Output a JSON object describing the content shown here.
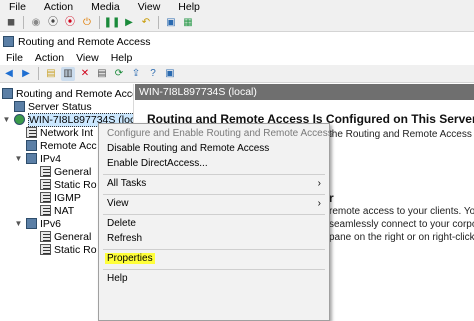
{
  "vm_menu": [
    "File",
    "Action",
    "Media",
    "View",
    "Help"
  ],
  "window_title": "Routing and Remote Access",
  "app_menu": [
    "File",
    "Action",
    "View",
    "Help"
  ],
  "tree": {
    "root": "Routing and Remote Access",
    "server_status": "Server Status",
    "server": "WIN-7I8L897734S (local)",
    "items": [
      "Network Int",
      "Remote Acc",
      "IPv4",
      "General",
      "Static Ro",
      "IGMP",
      "NAT",
      "IPv6",
      "General",
      "Static Ro"
    ]
  },
  "right": {
    "header": "WIN-7I8L897734S (local)",
    "title": "Routing and Remote Access Is Configured on This Server",
    "line1": "the Routing and Remote Access",
    "line2": "r",
    "line3": "remote access to your clients. You e",
    "line4": "seamlessly connect to your corporate",
    "line5": "pane on the right or on right-clicking t"
  },
  "context_menu": {
    "configure": "Configure and Enable Routing and Remote Access",
    "disable": "Disable Routing and Remote Access",
    "enable_direct": "Enable DirectAccess...",
    "all_tasks": "All Tasks",
    "view": "View",
    "delete": "Delete",
    "refresh": "Refresh",
    "properties": "Properties",
    "help": "Help"
  },
  "colors": {
    "highlight": "#ffff3a",
    "header_bg": "#6f6f6f",
    "selection": "#cce8ff"
  }
}
